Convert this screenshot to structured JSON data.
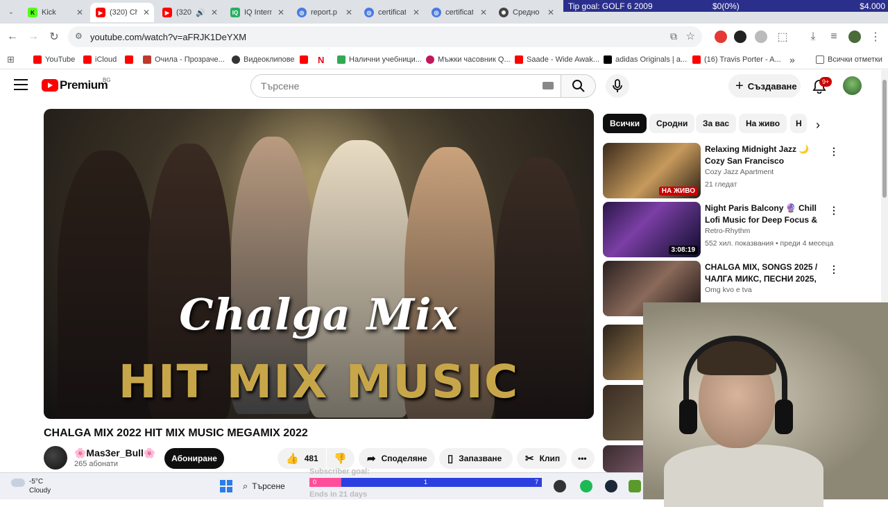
{
  "browser": {
    "tabs": [
      {
        "title": "Kick",
        "favicon": "kick-icon",
        "color": "#53fc18"
      },
      {
        "title": "(320) Ch",
        "favicon": "youtube-icon",
        "color": "#ff0000"
      },
      {
        "title": "(320",
        "favicon": "youtube-icon",
        "color": "#ff0000"
      },
      {
        "title": "IQ Intern",
        "favicon": "iq-icon",
        "color": "#27ae60"
      },
      {
        "title": "report.p",
        "favicon": "globe-icon",
        "color": "#4a7be0"
      },
      {
        "title": "certificat",
        "favicon": "globe-icon",
        "color": "#4a7be0"
      },
      {
        "title": "certificat",
        "favicon": "globe-icon",
        "color": "#4a7be0"
      },
      {
        "title": "Средно",
        "favicon": "chatgpt-icon",
        "color": "#444444"
      }
    ],
    "url": "youtube.com/watch?v=aFRJK1DeYXM",
    "bookmarks": [
      {
        "label": "YouTube",
        "color": "#ff0000"
      },
      {
        "label": "iCloud",
        "color": "#ff0000"
      },
      {
        "label": "",
        "color": "#ff0000"
      },
      {
        "label": "Очила - Прозраче...",
        "color": "#c0392b"
      },
      {
        "label": "Видеоклипове",
        "color": "#333333"
      },
      {
        "label": "",
        "color": "#ff0000"
      },
      {
        "label": "",
        "color": "#e50914"
      },
      {
        "label": "Налични учебници...",
        "color": "#34a853"
      },
      {
        "label": "Мъжки часовник Q...",
        "color": "#c2185b"
      },
      {
        "label": "Saade - Wide Awak...",
        "color": "#ff0000"
      },
      {
        "label": "adidas Originals | а...",
        "color": "#000000"
      },
      {
        "label": "(16) Travis Porter - A...",
        "color": "#ff0000"
      }
    ],
    "bookmarks_more": "»",
    "all_bookmarks": "Всички отметки"
  },
  "stream_overlay": {
    "tip_goal": "Tip goal: GOLF 6 2009",
    "progress": "$0(0%)",
    "target": "$4.000"
  },
  "youtube": {
    "logo_text": "Premium",
    "region": "BG",
    "search_placeholder": "Търсене",
    "create_label": "Създаване",
    "notifications_count": "9+",
    "video": {
      "thumbnail_line1": "Chalga Mix",
      "thumbnail_line2": "HIT MIX MUSIC",
      "title": "CHALGA MIX 2022 HIT MIX MUSIC MEGAMIX 2022",
      "channel": "🌸Mas3er_Bull🌸",
      "subscribers": "265 абонати",
      "subscribe_label": "Абониране",
      "likes": "481",
      "share_label": "Споделяне",
      "save_label": "Запазване",
      "clip_label": "Клип"
    },
    "chips": [
      "Всички",
      "Сродни",
      "За вас",
      "На живо",
      "Н"
    ],
    "recommendations": [
      {
        "title": "Relaxing Midnight Jazz 🌙 Cozy San Francisco Apartmen...",
        "channel": "Cozy Jazz Apartment",
        "meta": "21 гледат",
        "badge": "НА ЖИВО",
        "badge_type": "live"
      },
      {
        "title": "Night Paris Balcony 🔮 Chill Lofi Music for Deep Focus & ...",
        "channel": "Retro-Rhythm",
        "meta": "552 хил. показвания • преди 4 месеца",
        "badge": "3:08:19",
        "badge_type": "duration"
      },
      {
        "title": "CHALGA MIX, SONGS 2025 / ЧАЛГА МИКС, ПЕСНИ 2025, ...",
        "channel": "Omg kvo e tva",
        "meta": "",
        "badge": "",
        "badge_type": "none"
      }
    ]
  },
  "taskbar": {
    "temperature": "-5°C",
    "condition": "Cloudy",
    "search_label": "Търсене",
    "subscriber_goal": "Subscriber goal:",
    "goal_start": "0",
    "goal_current": "1",
    "goal_target": "7",
    "goal_end": "Ends in 21 days"
  }
}
